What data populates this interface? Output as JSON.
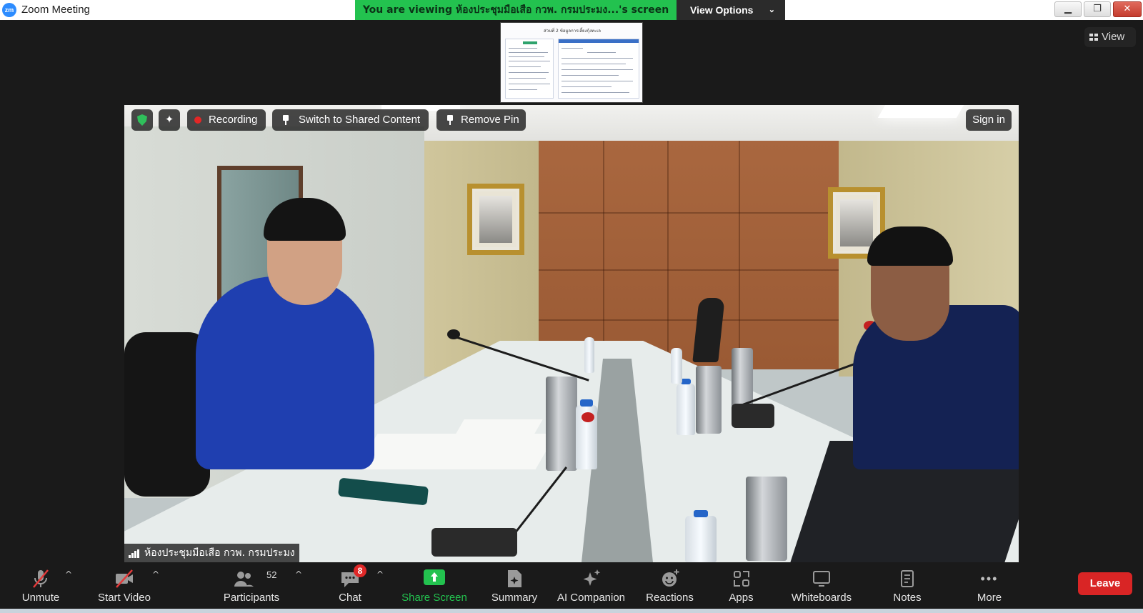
{
  "window": {
    "title": "Zoom Meeting",
    "logo_text": "zm",
    "controls": {
      "minimize": "▁",
      "maximize": "❐",
      "close": "✕"
    }
  },
  "banner": {
    "viewing_text": "You are viewing ห้องประชุมมือเสือ กวพ. กรมประมง...'s screen",
    "view_options_label": "View Options",
    "view_options_chevron": "⌄"
  },
  "top_right": {
    "view_label": "View"
  },
  "shared_screen": {
    "thumbnail_title": "ส่วนที่ 2  ข้อมูลการเลี้ยงกุ้งทะเล"
  },
  "video": {
    "overlay": {
      "ai_icon_glyph": "✦",
      "recording_label": "Recording",
      "switch_label": "Switch to Shared Content",
      "remove_pin_label": "Remove Pin",
      "sign_in_label": "Sign in"
    },
    "participant_name": "ห้องประชุมมือเสือ กวพ. กรมประมง"
  },
  "toolbar": {
    "unmute_label": "Unmute",
    "start_video_label": "Start Video",
    "participants_label": "Participants",
    "participants_count": "52",
    "chat_label": "Chat",
    "chat_badge": "8",
    "share_screen_label": "Share Screen",
    "summary_label": "Summary",
    "ai_companion_label": "AI Companion",
    "reactions_label": "Reactions",
    "apps_label": "Apps",
    "whiteboards_label": "Whiteboards",
    "notes_label": "Notes",
    "more_label": "More",
    "more_glyph": "•••",
    "caret_glyph": "^",
    "leave_label": "Leave"
  },
  "colors": {
    "banner_green": "#23c24f",
    "leave_red": "#d92525",
    "recording_red": "#e32726",
    "badge_red": "#e02828",
    "zoom_blue": "#2d8cff"
  },
  "icons": {
    "unmute": "microphone-muted-icon",
    "start_video": "video-camera-off-icon",
    "participants": "people-icon",
    "chat": "chat-bubble-icon",
    "share_screen": "share-arrow-up-icon",
    "summary": "summary-document-icon",
    "ai_companion": "sparkle-icon",
    "reactions": "smiley-plus-icon",
    "apps": "apps-grid-icon",
    "whiteboards": "whiteboard-icon",
    "notes": "notes-icon",
    "more": "ellipsis-icon",
    "security": "shield-check-icon",
    "pin": "pin-icon",
    "signal": "signal-bars-icon"
  }
}
